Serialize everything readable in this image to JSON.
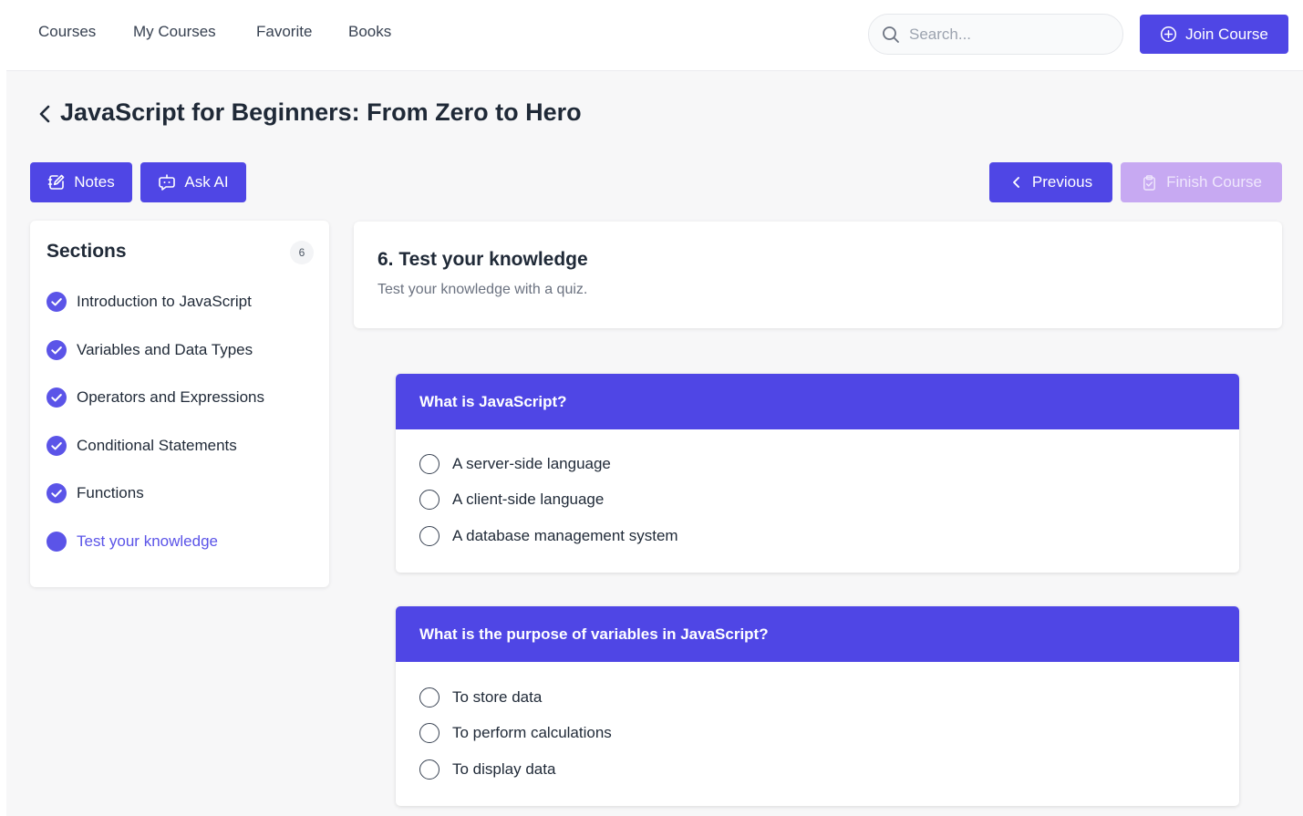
{
  "nav": {
    "links": [
      "Courses",
      "My Courses",
      "Favorite",
      "Books"
    ],
    "search_placeholder": "Search...",
    "join_label": "Join Course"
  },
  "course": {
    "title": "JavaScript for Beginners: From Zero to Hero"
  },
  "toolbar": {
    "notes_label": "Notes",
    "ask_ai_label": "Ask AI",
    "previous_label": "Previous",
    "finish_label": "Finish Course"
  },
  "sidebar": {
    "title": "Sections",
    "count": "6",
    "items": [
      {
        "label": "Introduction to JavaScript",
        "status": "completed"
      },
      {
        "label": "Variables and Data Types",
        "status": "completed"
      },
      {
        "label": "Operators and Expressions",
        "status": "completed"
      },
      {
        "label": "Conditional Statements",
        "status": "completed"
      },
      {
        "label": "Functions",
        "status": "completed"
      },
      {
        "label": "Test your knowledge",
        "status": "current"
      }
    ]
  },
  "section": {
    "heading": "6. Test your knowledge",
    "description": "Test your knowledge with a quiz."
  },
  "quiz": [
    {
      "question": "What is JavaScript?",
      "options": [
        "A server-side language",
        "A client-side language",
        "A database management system"
      ]
    },
    {
      "question": "What is the purpose of variables in JavaScript?",
      "options": [
        "To store data",
        "To perform calculations",
        "To display data"
      ]
    }
  ],
  "colors": {
    "accent": "#4f46e5",
    "accent_light": "#5b54e8",
    "disabled_button": "#c7a9f2"
  },
  "icons": {
    "search": "search-icon",
    "join": "plus-circle-icon",
    "back": "chevron-left-icon",
    "notes": "edit-note-icon",
    "ask_ai": "chat-bot-icon",
    "previous": "chevron-left-icon",
    "finish": "clipboard-check-icon",
    "section_done": "check-circle-icon"
  }
}
